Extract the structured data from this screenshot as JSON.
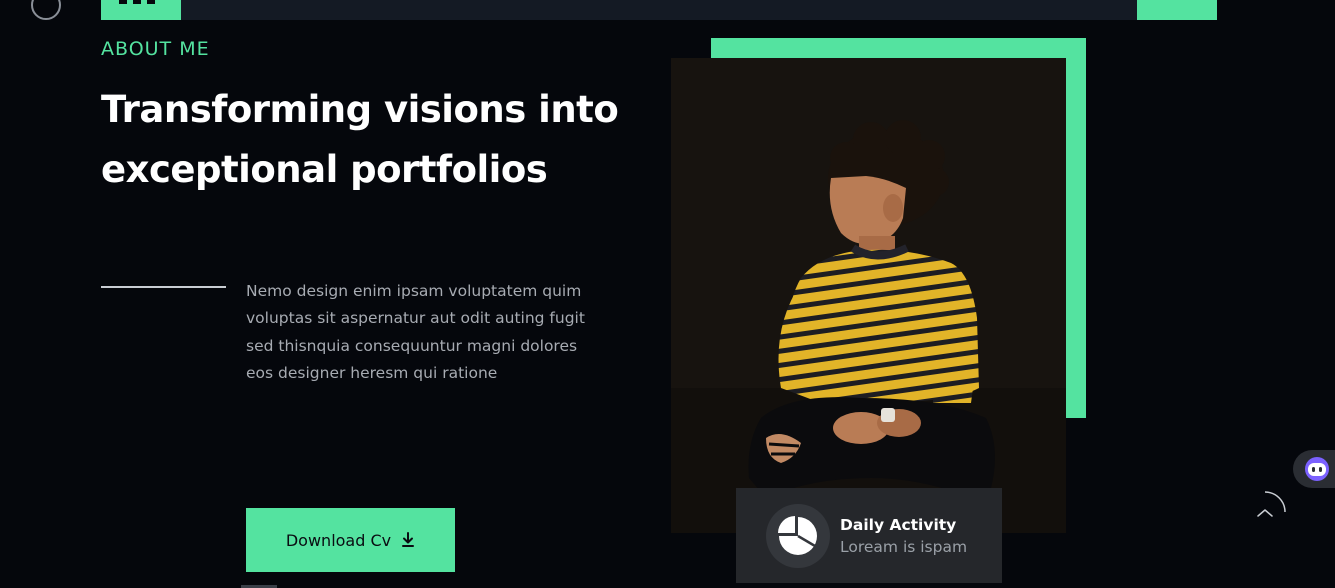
{
  "nav": {
    "accent_color": "#54e3a0",
    "bar_color": "#141a24"
  },
  "about": {
    "eyebrow": "ABOUT ME",
    "headline_line1": "Transforming visions into",
    "headline_line2": "exceptional portfolios",
    "paragraph": "Nemo design enim ipsam voluptatem quim voluptas sit aspernatur aut odit auting fugit sed thisnquia consequuntur magni dolores eos designer heresm qui ratione",
    "cv_button_label": "Download Cv",
    "cv_button_icon": "download-icon"
  },
  "activity_card": {
    "icon": "pie-chart-icon",
    "title": "Daily Activity",
    "subtitle": "Loream is ispam"
  },
  "widgets": {
    "chat_icon": "chat-bot-icon",
    "scroll_top_icon": "chevron-up-icon"
  },
  "colors": {
    "background": "#05070c",
    "accent": "#54e3a0",
    "card": "#25272b",
    "muted_text": "#a7abb2"
  }
}
